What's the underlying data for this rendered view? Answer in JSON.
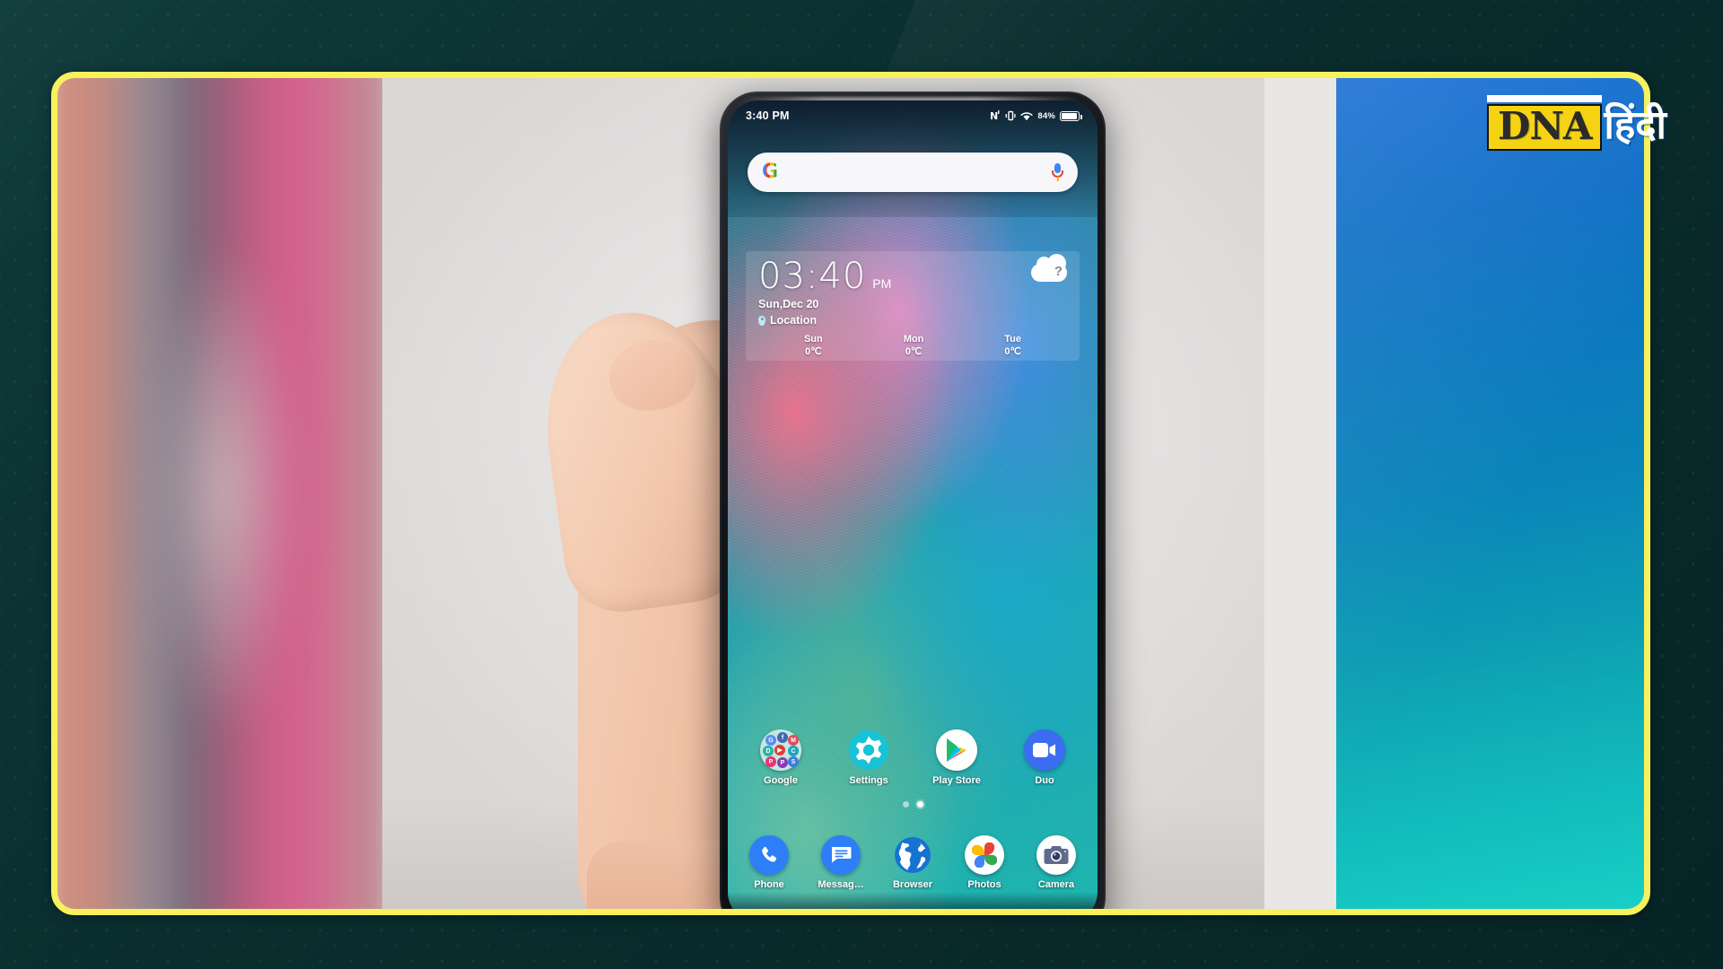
{
  "brand": {
    "logo_primary": "DNA",
    "logo_secondary": "हिंदी",
    "accent_yellow": "#f5d313",
    "frame_yellow": "#f7f15c",
    "backdrop_teal": "#0b2f30",
    "panel_blue": "#1a6fd4",
    "panel_teal": "#18cfc6"
  },
  "frame": {
    "border_color": "#f7f15c"
  },
  "phone": {
    "status_bar": {
      "time": "3:40 PM",
      "nfc_icon": "nfc-icon",
      "vibrate_icon": "vibrate-icon",
      "wifi_icon": "wifi-icon",
      "battery_percent": "84%",
      "battery_icon": "battery-icon"
    },
    "search": {
      "google_letter": "G",
      "placeholder": "",
      "value": "",
      "mic_icon": "mic-icon"
    },
    "clock_widget": {
      "time": "03:40",
      "ampm": "PM",
      "date": "Sun,Dec 20",
      "location": "Location",
      "location_icon": "location-pin-icon",
      "weather_icon": "cloud-unknown-icon",
      "weather_unknown_glyph": "?",
      "forecast": [
        {
          "day": "Sun",
          "temp": "0℃"
        },
        {
          "day": "Mon",
          "temp": "0℃"
        },
        {
          "day": "Tue",
          "temp": "0℃"
        }
      ]
    },
    "app_row": [
      {
        "label": "Google",
        "icon": "google-folder-icon"
      },
      {
        "label": "Settings",
        "icon": "settings-gear-icon"
      },
      {
        "label": "Play Store",
        "icon": "play-store-icon"
      },
      {
        "label": "Duo",
        "icon": "duo-video-icon"
      }
    ],
    "page_indicator": {
      "total": 2,
      "active_index": 1
    },
    "dock": [
      {
        "label": "Phone",
        "icon": "phone-handset-icon"
      },
      {
        "label": "Messag…",
        "icon": "messages-bubble-icon"
      },
      {
        "label": "Browser",
        "icon": "browser-globe-icon"
      },
      {
        "label": "Photos",
        "icon": "google-photos-icon"
      },
      {
        "label": "Camera",
        "icon": "camera-icon"
      }
    ]
  }
}
